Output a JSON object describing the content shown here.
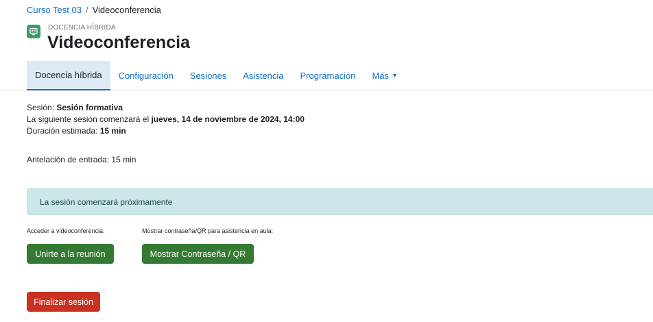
{
  "breadcrumb": {
    "course": "Curso Test 03",
    "separator": "/",
    "current": "Videoconferencia"
  },
  "module": {
    "type": "DOCENCIA HÍBRIDA",
    "title": "Videoconferencia",
    "icon": "video-meeting-icon",
    "icon_color": "#399b6a"
  },
  "tabs": [
    {
      "label": "Docencia híbrida",
      "active": true
    },
    {
      "label": "Configuración"
    },
    {
      "label": "Sesiones"
    },
    {
      "label": "Asistencia"
    },
    {
      "label": "Programación"
    },
    {
      "label": "Más"
    }
  ],
  "session": {
    "session_prefix": "Sesión: ",
    "session_name": "Sesión formativa",
    "next_prefix": "La siguiente sesión comenzará el ",
    "next_date": "jueves, 14 de noviembre de 2024, 14:00",
    "duration_prefix": "Duración estimada: ",
    "duration": "15 min",
    "advance": "Antelación de entrada: 15 min"
  },
  "alert": {
    "text": "La sesión comenzará próximamente"
  },
  "actions": {
    "join_label": "Acceder a videoconferencia:",
    "join_button": "Unirte a la reunión",
    "qr_label": "Mostrar contraseña/QR para asistencia en aula:",
    "qr_button": "Mostrar Contraseña / QR",
    "finish_button": "Finalizar sesión"
  },
  "colors": {
    "link": "#0f6cbf",
    "success": "#357a32",
    "danger": "#ca3120",
    "info_bg": "#cce6ea"
  }
}
